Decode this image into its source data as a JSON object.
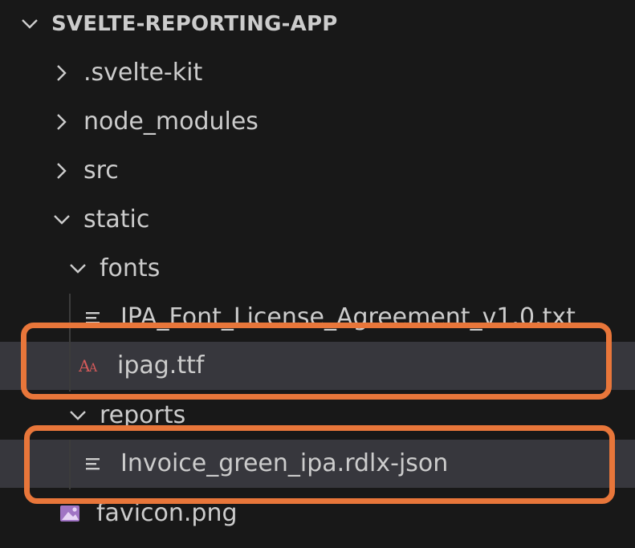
{
  "explorer": {
    "root": {
      "label": "SVELTE-REPORTING-APP",
      "expanded": true
    },
    "items": [
      {
        "label": ".svelte-kit",
        "type": "folder",
        "expanded": false
      },
      {
        "label": "node_modules",
        "type": "folder",
        "expanded": false
      },
      {
        "label": "src",
        "type": "folder",
        "expanded": false
      },
      {
        "label": "static",
        "type": "folder",
        "expanded": true
      },
      {
        "label": "fonts",
        "type": "folder",
        "expanded": true
      },
      {
        "label": "IPA_Font_License_Agreement_v1.0.txt",
        "type": "file",
        "icon": "text-file-icon"
      },
      {
        "label": "ipag.ttf",
        "type": "file",
        "icon": "font-file-icon"
      },
      {
        "label": "reports",
        "type": "folder",
        "expanded": true
      },
      {
        "label": "Invoice_green_ipa.rdlx-json",
        "type": "file",
        "icon": "text-file-icon"
      },
      {
        "label": "favicon.png",
        "type": "file",
        "icon": "image-file-icon"
      }
    ]
  },
  "colors": {
    "background": "#181818",
    "selected_row": "#37373d",
    "highlight_border": "#e8763a",
    "font_icon": "#d45a5a",
    "image_icon": "#a074c4"
  }
}
